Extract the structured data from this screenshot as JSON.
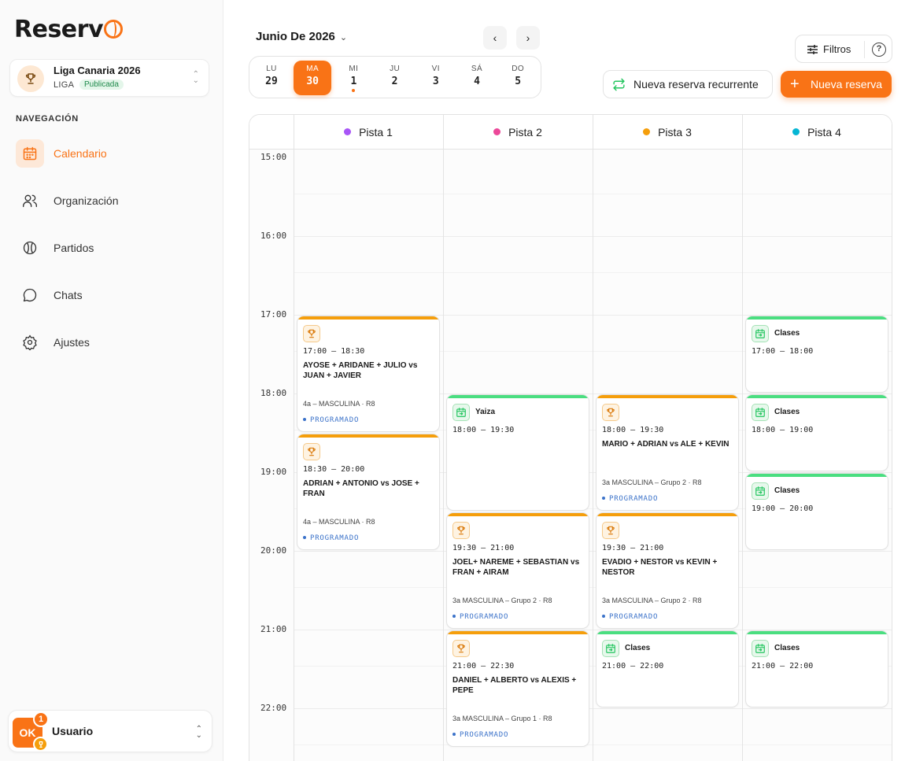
{
  "brand": {
    "name": "Reserv"
  },
  "league": {
    "name": "Liga Canaria 2026",
    "type": "LIGA",
    "status": "Publicada"
  },
  "nav": {
    "heading": "NAVEGACIÓN",
    "items": [
      {
        "label": "Calendario",
        "icon": "calendar-icon",
        "active": true
      },
      {
        "label": "Organización",
        "icon": "users-icon",
        "active": false
      },
      {
        "label": "Partidos",
        "icon": "ball-icon",
        "active": false
      },
      {
        "label": "Chats",
        "icon": "chat-icon",
        "active": false
      },
      {
        "label": "Ajustes",
        "icon": "gear-icon",
        "active": false
      }
    ]
  },
  "user": {
    "avatar": "OK",
    "notifications": "1",
    "name": "Usuario"
  },
  "header": {
    "month": "Junio De 2026"
  },
  "days": [
    {
      "label": "LU",
      "num": "29",
      "active": false,
      "dot": false
    },
    {
      "label": "MA",
      "num": "30",
      "active": true,
      "dot": false
    },
    {
      "label": "MI",
      "num": "1",
      "active": false,
      "dot": true
    },
    {
      "label": "JU",
      "num": "2",
      "active": false,
      "dot": false
    },
    {
      "label": "VI",
      "num": "3",
      "active": false,
      "dot": false
    },
    {
      "label": "SÁ",
      "num": "4",
      "active": false,
      "dot": false
    },
    {
      "label": "DO",
      "num": "5",
      "active": false,
      "dot": false
    }
  ],
  "actions": {
    "filters": "Filtros",
    "help": "?",
    "recurring": "Nueva reserva recurrente",
    "new": "Nueva reserva",
    "plus": "+"
  },
  "colors": {
    "accent": "#f97316",
    "match": "#f59e0b",
    "class": "#4ade80",
    "status": "#3b72c9"
  },
  "courts": [
    {
      "name": "Pista 1",
      "color": "#a855f7"
    },
    {
      "name": "Pista 2",
      "color": "#ec4899"
    },
    {
      "name": "Pista 3",
      "color": "#f59e0b"
    },
    {
      "name": "Pista 4",
      "color": "#06b6d4"
    }
  ],
  "times": [
    "15:00",
    "16:00",
    "17:00",
    "18:00",
    "19:00",
    "20:00",
    "21:00",
    "22:00"
  ],
  "events": [
    {
      "court": 0,
      "start": "17:00",
      "end": "18:30",
      "type": "match",
      "time": "17:00 – 18:30",
      "teams": "AYOSE + ARIDANE + JULIO vs JUAN + JAVIER",
      "category": "4a – MASCULINA · R8",
      "status": "PROGRAMADO"
    },
    {
      "court": 0,
      "start": "18:30",
      "end": "20:00",
      "type": "match",
      "time": "18:30 – 20:00",
      "teams": "ADRIAN + ANTONIO vs JOSE + FRAN",
      "category": "4a – MASCULINA · R8",
      "status": "PROGRAMADO"
    },
    {
      "court": 1,
      "start": "18:00",
      "end": "19:30",
      "type": "clase",
      "title": "Yaiza",
      "time": "18:00 – 19:30"
    },
    {
      "court": 1,
      "start": "19:30",
      "end": "21:00",
      "type": "match",
      "time": "19:30 – 21:00",
      "teams": "JOEL+ NAREME + SEBASTIAN vs FRAN + AIRAM",
      "category": "3a MASCULINA – Grupo 2 · R8",
      "status": "PROGRAMADO"
    },
    {
      "court": 1,
      "start": "21:00",
      "end": "22:30",
      "type": "match",
      "time": "21:00 – 22:30",
      "teams": "DANIEL + ALBERTO vs ALEXIS + PEPE",
      "category": "3a MASCULINA – Grupo 1 · R8",
      "status": "PROGRAMADO"
    },
    {
      "court": 2,
      "start": "18:00",
      "end": "19:30",
      "type": "match",
      "time": "18:00 – 19:30",
      "teams": "MARIO + ADRIAN vs ALE + KEVIN",
      "category": "3a MASCULINA – Grupo 2 · R8",
      "status": "PROGRAMADO"
    },
    {
      "court": 2,
      "start": "19:30",
      "end": "21:00",
      "type": "match",
      "time": "19:30 – 21:00",
      "teams": "EVADIO + NESTOR vs KEVIN + NESTOR",
      "category": "3a MASCULINA – Grupo 2 · R8",
      "status": "PROGRAMADO"
    },
    {
      "court": 2,
      "start": "21:00",
      "end": "22:00",
      "type": "clase",
      "title": "Clases",
      "time": "21:00 – 22:00"
    },
    {
      "court": 3,
      "start": "17:00",
      "end": "18:00",
      "type": "clase",
      "title": "Clases",
      "time": "17:00 – 18:00"
    },
    {
      "court": 3,
      "start": "18:00",
      "end": "19:00",
      "type": "clase",
      "title": "Clases",
      "time": "18:00 – 19:00"
    },
    {
      "court": 3,
      "start": "19:00",
      "end": "20:00",
      "type": "clase",
      "title": "Clases",
      "time": "19:00 – 20:00"
    },
    {
      "court": 3,
      "start": "21:00",
      "end": "22:00",
      "type": "clase",
      "title": "Clases",
      "time": "21:00 – 22:00"
    }
  ]
}
